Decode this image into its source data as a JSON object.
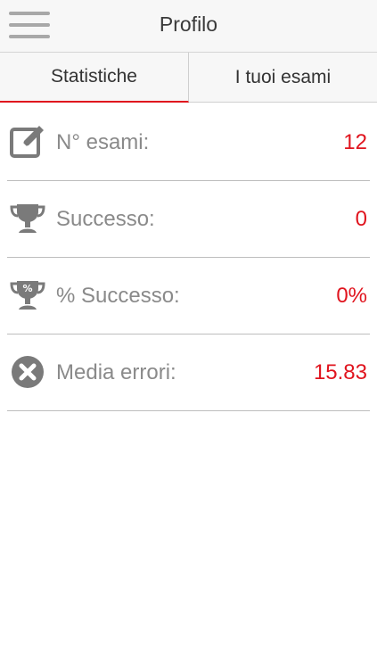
{
  "header": {
    "title": "Profilo",
    "menu_icon": "hamburger-menu-icon"
  },
  "tabs": [
    {
      "label": "Statistiche",
      "active": true
    },
    {
      "label": "I tuoi esami",
      "active": false
    }
  ],
  "stats": [
    {
      "label": "N° esami:",
      "value": "12",
      "icon": "edit-icon"
    },
    {
      "label": "Successo:",
      "value": "0",
      "icon": "trophy-icon"
    },
    {
      "label": "% Successo:",
      "value": "0%",
      "icon": "trophy-percent-icon"
    },
    {
      "label": "Media errori:",
      "value": "15.83",
      "icon": "error-circle-icon"
    }
  ],
  "colors": {
    "accent": "#e0141e",
    "icon_gray": "#7a7a7a",
    "label_gray": "#8a8a8a"
  }
}
